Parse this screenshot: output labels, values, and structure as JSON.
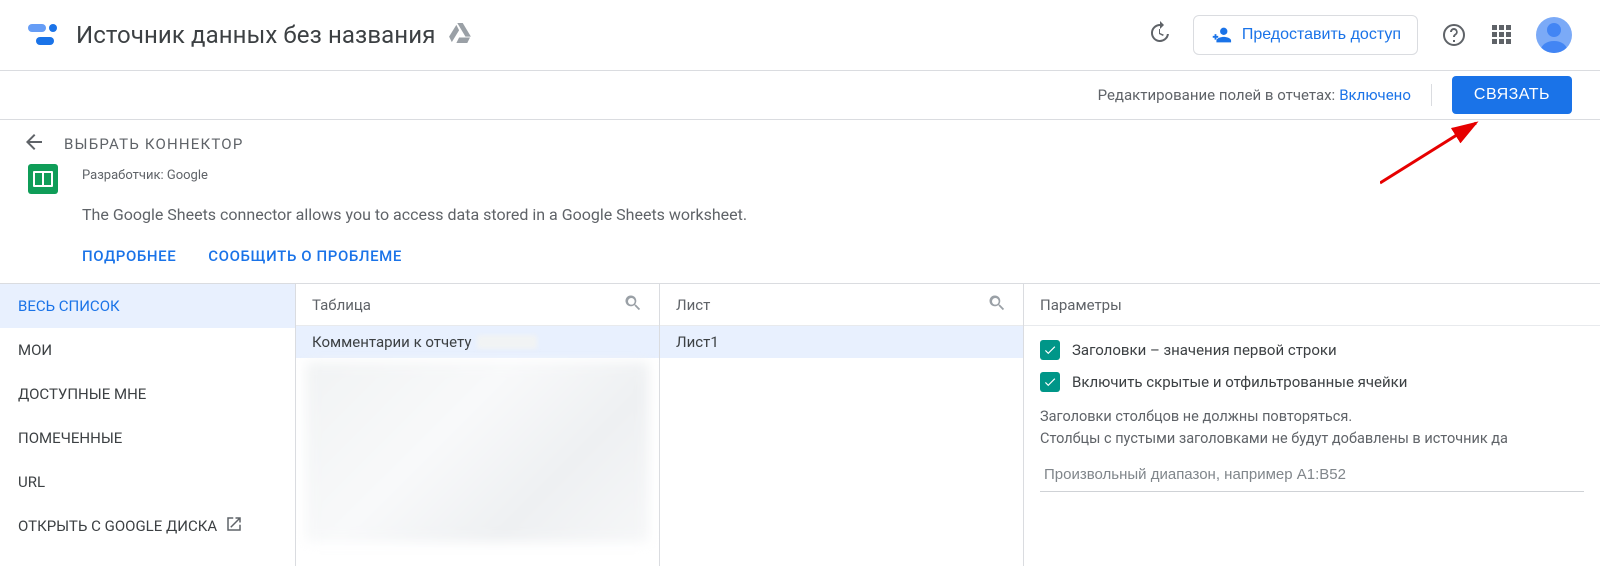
{
  "header": {
    "title": "Источник данных без названия",
    "share_label": "Предоставить доступ"
  },
  "editbar": {
    "field_edit_label": "Редактирование полей в отчетах:",
    "field_edit_value": "Включено",
    "connect_label": "СВЯЗАТЬ"
  },
  "connector_nav": {
    "back_label": "ВЫБРАТЬ КОННЕКТОР"
  },
  "connector": {
    "developer": "Разработчик: Google",
    "description": "The Google Sheets connector allows you to access data stored in a Google Sheets worksheet.",
    "learn_more": "ПОДРОБНЕЕ",
    "report_issue": "СООБЩИТЬ О ПРОБЛЕМЕ"
  },
  "picker": {
    "nav": {
      "items": [
        "ВЕСЬ СПИСОК",
        "МОИ",
        "ДОСТУПНЫЕ МНЕ",
        "ПОМЕЧЕННЫЕ",
        "URL",
        "ОТКРЫТЬ С GOOGLE ДИСКА"
      ],
      "active_index": 0
    },
    "tables": {
      "header": "Таблица",
      "items": [
        "Комментарии к отчету"
      ],
      "selected_index": 0
    },
    "sheets": {
      "header": "Лист",
      "items": [
        "Лист1"
      ],
      "selected_index": 0
    },
    "params": {
      "header": "Параметры",
      "opt_headers": "Заголовки – значения первой строки",
      "opt_hidden": "Включить скрытые и отфильтрованные ячейки",
      "hint_line1": "Заголовки столбцов не должны повторяться.",
      "hint_line2": "Столбцы с пустыми заголовками не будут добавлены в источник да",
      "range_placeholder": "Произвольный диапазон, например A1:B52"
    }
  }
}
